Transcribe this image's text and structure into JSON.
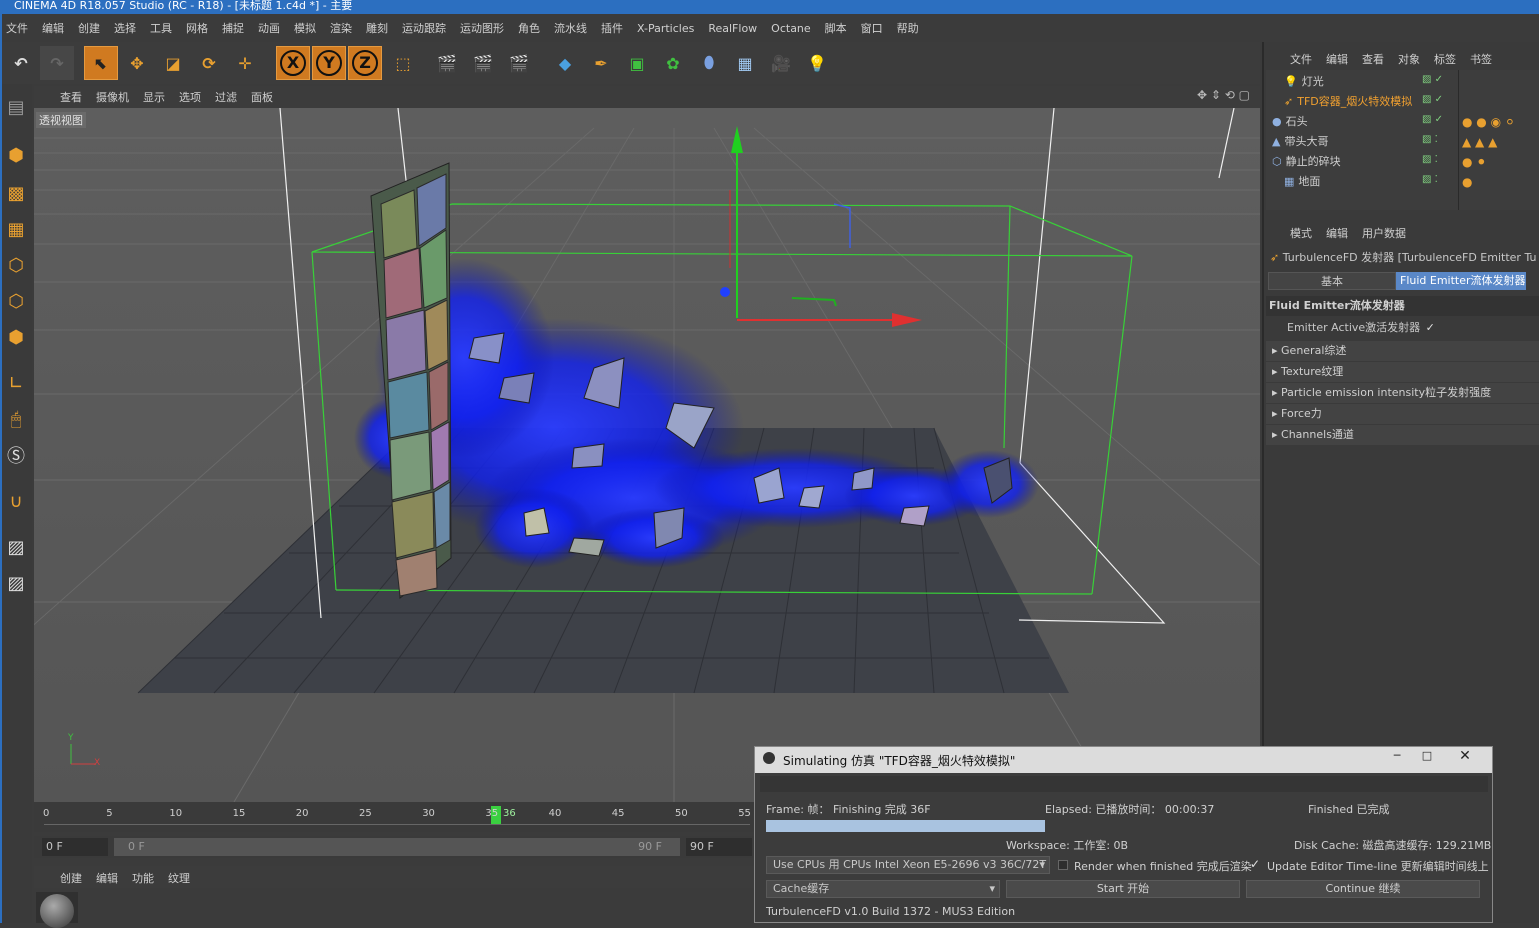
{
  "window": {
    "title": "CINEMA 4D R18.057 Studio (RC - R18) - [未标题 1.c4d *] - 主要"
  },
  "menubar": [
    "文件",
    "编辑",
    "创建",
    "选择",
    "工具",
    "网格",
    "捕捉",
    "动画",
    "模拟",
    "渲染",
    "雕刻",
    "运动跟踪",
    "运动图形",
    "角色",
    "流水线",
    "插件",
    "X-Particles",
    "RealFlow",
    "Octane",
    "脚本",
    "窗口",
    "帮助"
  ],
  "toolbar": {
    "axis_x": "X",
    "axis_y": "Y",
    "axis_z": "Z",
    "icons": [
      "undo-icon",
      "redo-icon",
      "live-select-icon",
      "move-icon",
      "scale-icon",
      "rotate-icon",
      "recent-tool-icon",
      "x-axis-icon",
      "y-axis-icon",
      "z-axis-icon",
      "coordinate-system-icon",
      "render-view-icon",
      "render-picture-viewer-icon",
      "render-settings-icon",
      "cube-icon",
      "pen-icon",
      "subdivision-icon",
      "cloner-icon",
      "deformer-icon",
      "floor-icon",
      "camera-icon",
      "light-icon"
    ]
  },
  "viewport": {
    "menu": [
      "查看",
      "摄像机",
      "显示",
      "选项",
      "过滤",
      "面板"
    ],
    "label": "透视视图",
    "axis_y": "Y",
    "axis_x": "X"
  },
  "objects_panel": {
    "menu": [
      "文件",
      "编辑",
      "查看",
      "对象",
      "标签",
      "书签"
    ],
    "items": [
      {
        "name": "灯光",
        "color": "#cfcfcf"
      },
      {
        "name": "TFD容器_烟火特效模拟",
        "color": "#f0a030"
      },
      {
        "name": "石头",
        "color": "#cfcfcf"
      },
      {
        "name": "带头大哥",
        "color": "#cfcfcf"
      },
      {
        "name": "静止的碎块",
        "color": "#cfcfcf"
      },
      {
        "name": "地面",
        "color": "#cfcfcf"
      }
    ]
  },
  "attributes_panel": {
    "menu": [
      "模式",
      "编辑",
      "用户数据"
    ],
    "object_title": "TurbulenceFD 发射器 [TurbulenceFD Emitter Tu",
    "tabs": [
      "基本",
      "Fluid Emitter流体发射器"
    ],
    "section": "Fluid Emitter流体发射器",
    "emitter_active": "Emitter Active激活发射器",
    "emitter_active_check": "✓",
    "groups": [
      "General综述",
      "Texture纹理",
      "Particle emission intensity粒子发射强度",
      "Force力",
      "Channels通道"
    ]
  },
  "timeline": {
    "ticks": [
      "0",
      "5",
      "10",
      "15",
      "20",
      "25",
      "30",
      "35",
      "36",
      "40",
      "45",
      "50",
      "55"
    ],
    "current_frame": 36,
    "start_field": "0 F",
    "range_start": "0 F",
    "range_end": "90 F",
    "end_field": "90 F"
  },
  "material_panel": {
    "menu": [
      "创建",
      "编辑",
      "功能",
      "纹理"
    ]
  },
  "sim_dialog": {
    "title": "Simulating 仿真 \"TFD容器_烟火特效模拟\"",
    "frame_label": "Frame: 帧：  Finishing 完成 36F",
    "elapsed": "Elapsed: 已播放时间：  00:00:37",
    "finished": "Finished 已完成",
    "progress": 0.39,
    "workspace": "Workspace: 工作室: 0B",
    "disk_cache": "Disk Cache: 磁盘高速缓存: 129.21MB",
    "cpu_select": "Use CPUs 用 CPUs Intel Xeon E5-2696 v3 36C/72T",
    "render_when_finished": "Render when finished 完成后渲染",
    "update_editor": "Update Editor Time-line 更新编辑时间线上",
    "cache_select": "Cache缓存",
    "start_button": "Start 开始",
    "continue_button": "Continue 继续",
    "footer": "TurbulenceFD v1.0 Build 1372 - MUS3 Edition"
  }
}
